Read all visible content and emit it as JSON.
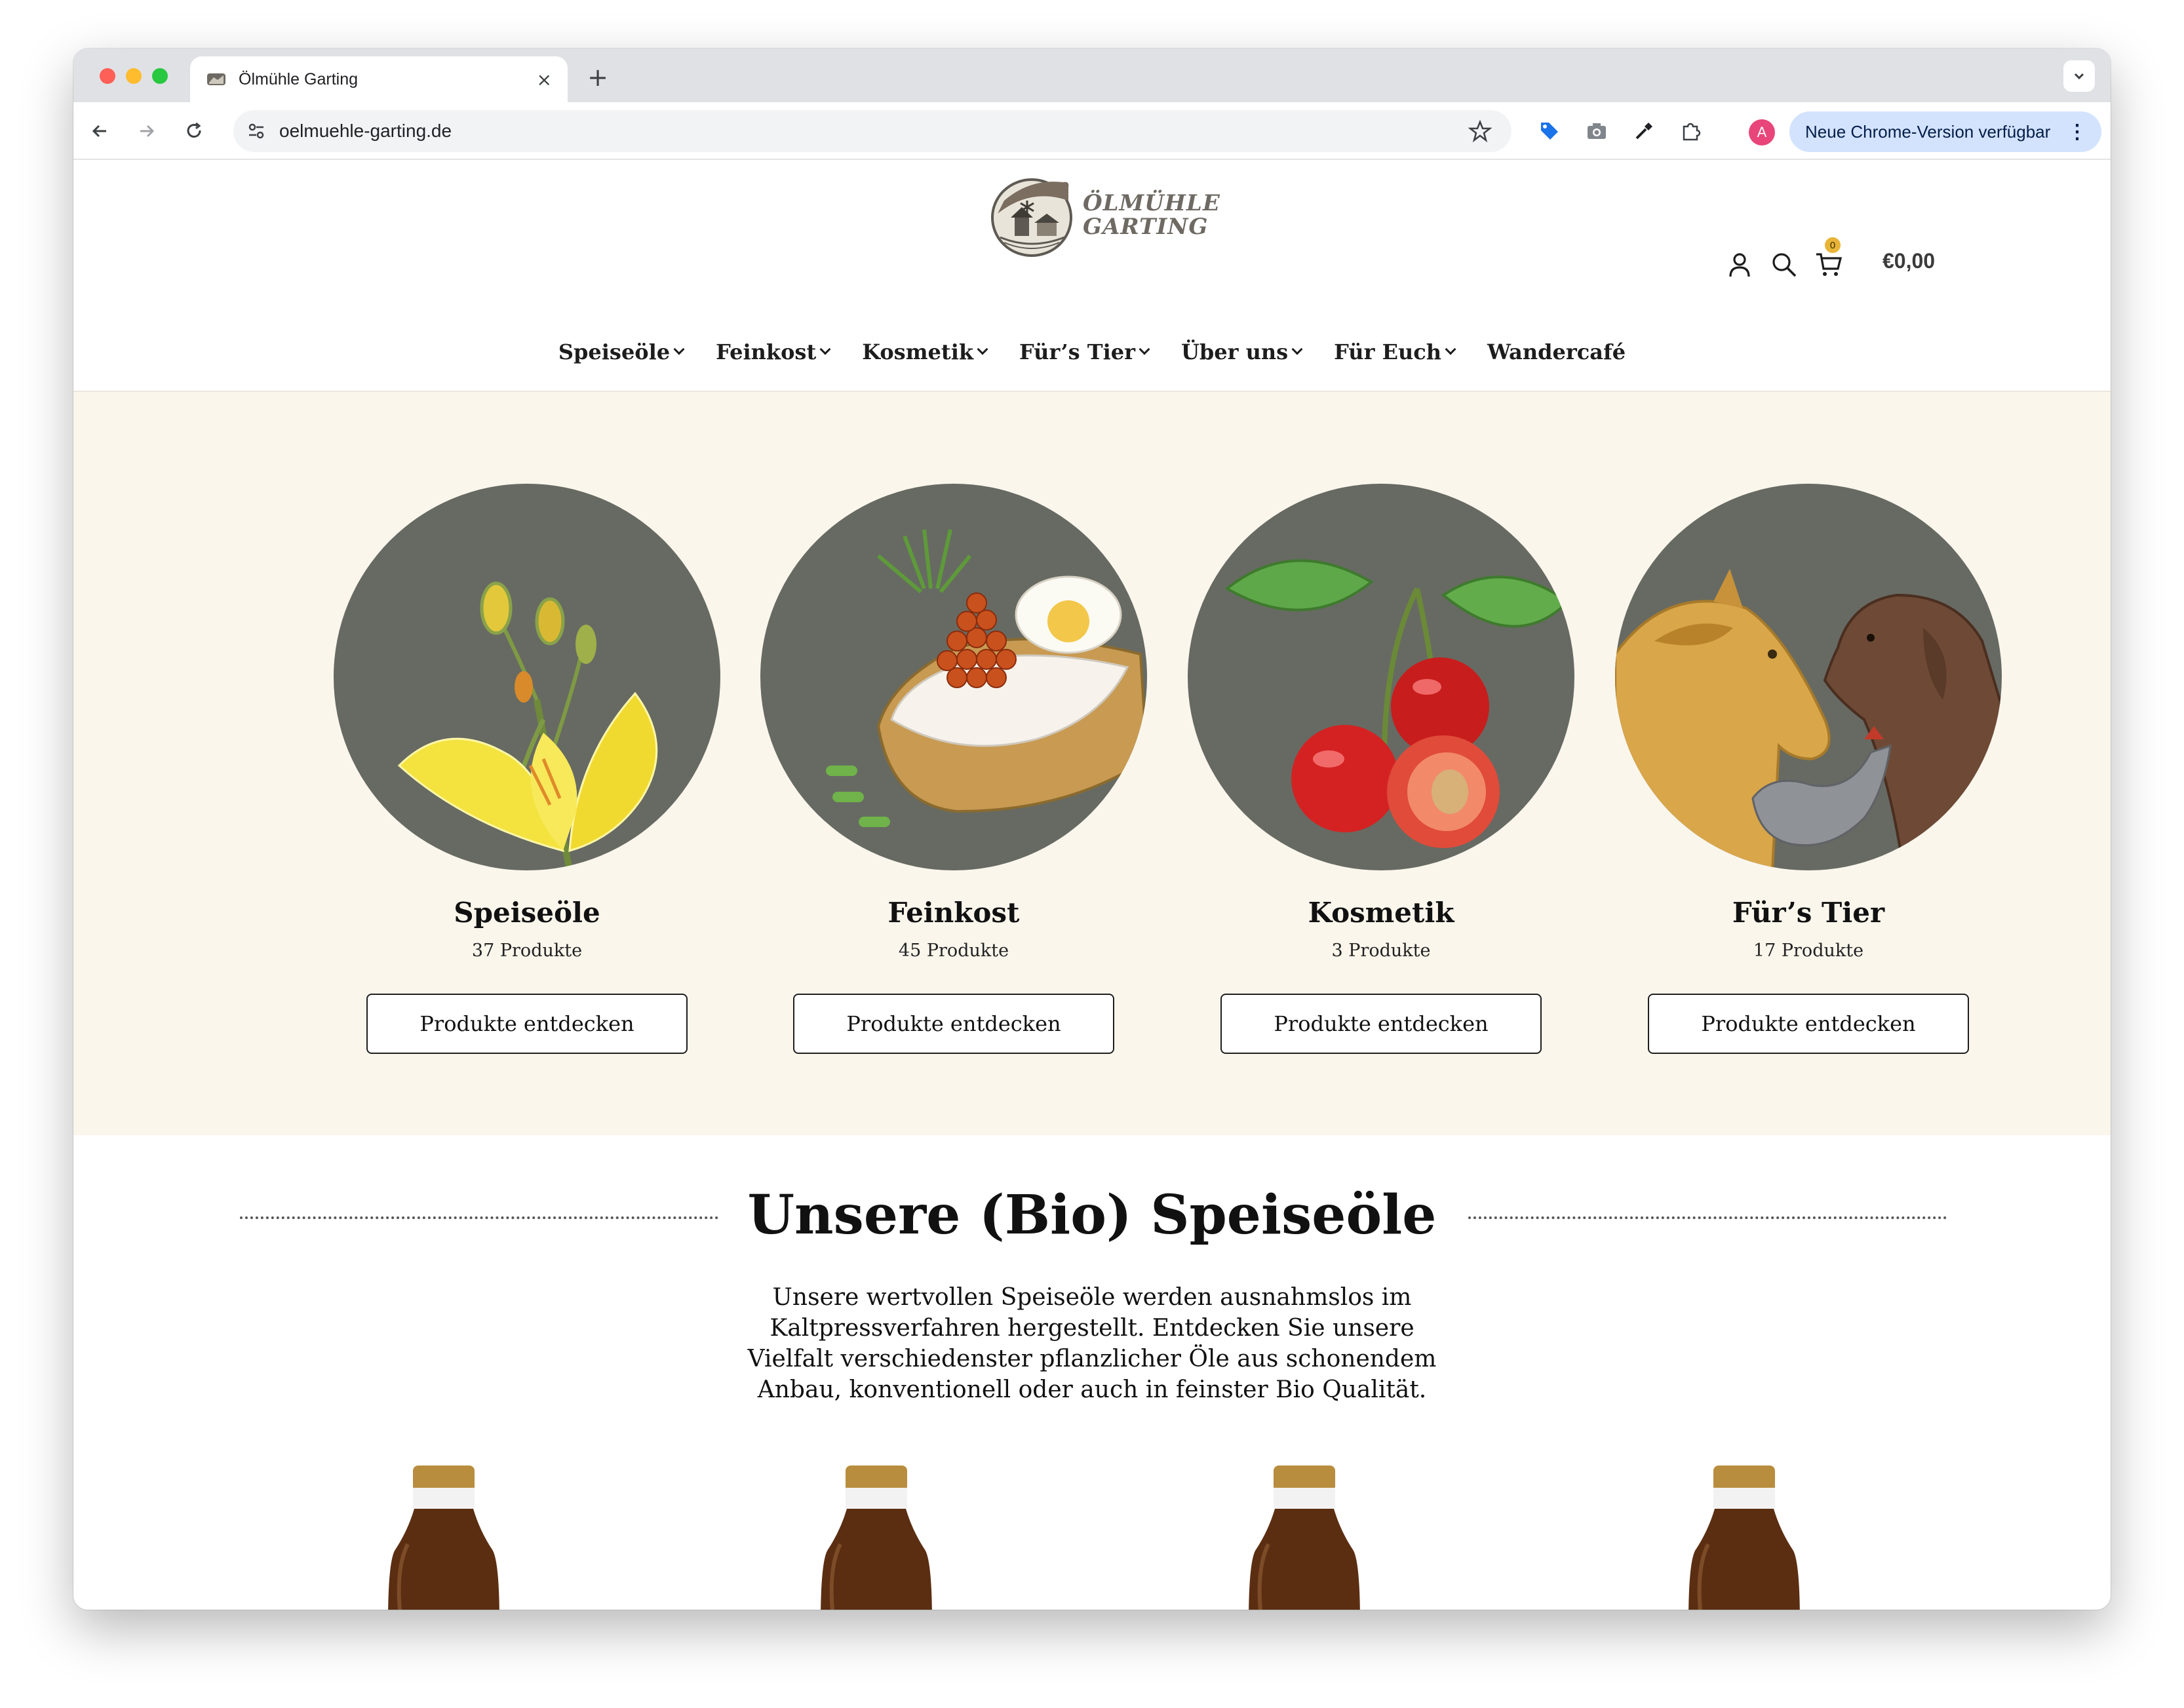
{
  "browser": {
    "tab_title": "Ölmühle Garting",
    "tab_close": "×",
    "new_tab": "+",
    "url": "oelmuehle-garting.de",
    "profile_initial": "A",
    "update_label": "Neue Chrome-Version verfügbar",
    "update_menu": "⋮"
  },
  "site": {
    "logo": {
      "line1": "ÖLMÜHLE",
      "line2": "GARTING"
    },
    "cart_count": "0",
    "cart_total": "€0,00",
    "nav": [
      {
        "label": "Speiseöle"
      },
      {
        "label": "Feinkost"
      },
      {
        "label": "Kosmetik"
      },
      {
        "label": "Für’s Tier"
      },
      {
        "label": "Über uns"
      },
      {
        "label": "Für Euch"
      },
      {
        "label": "Wandercafé"
      }
    ],
    "categories": [
      {
        "name": "Speiseöle",
        "count": "37 Produkte",
        "button": "Produkte entdecken",
        "image": "yellow-flower-illustration"
      },
      {
        "name": "Feinkost",
        "count": "45 Produkte",
        "button": "Produkte entdecken",
        "image": "caviar-bread-illustration"
      },
      {
        "name": "Kosmetik",
        "count": "3 Produkte",
        "button": "Produkte entdecken",
        "image": "cherries-illustration"
      },
      {
        "name": "Für’s Tier",
        "count": "17 Produkte",
        "button": "Produkte entdecken",
        "image": "horse-dog-chicken-illustration"
      }
    ],
    "section": {
      "title": "Unsere (Bio) Speiseöle",
      "text": "Unsere wertvollen Speiseöle werden ausnahmslos im Kaltpressverfahren hergestellt. Entdecken Sie unsere Vielfalt verschiedenster pflanzlicher Öle aus schonendem Anbau, konventionell oder auch in feinster Bio Qualität."
    },
    "colors": {
      "band": "#faf6ec",
      "circle": "#676a62",
      "badge": "#e8b437",
      "update_pill": "#d3e3fd"
    }
  }
}
